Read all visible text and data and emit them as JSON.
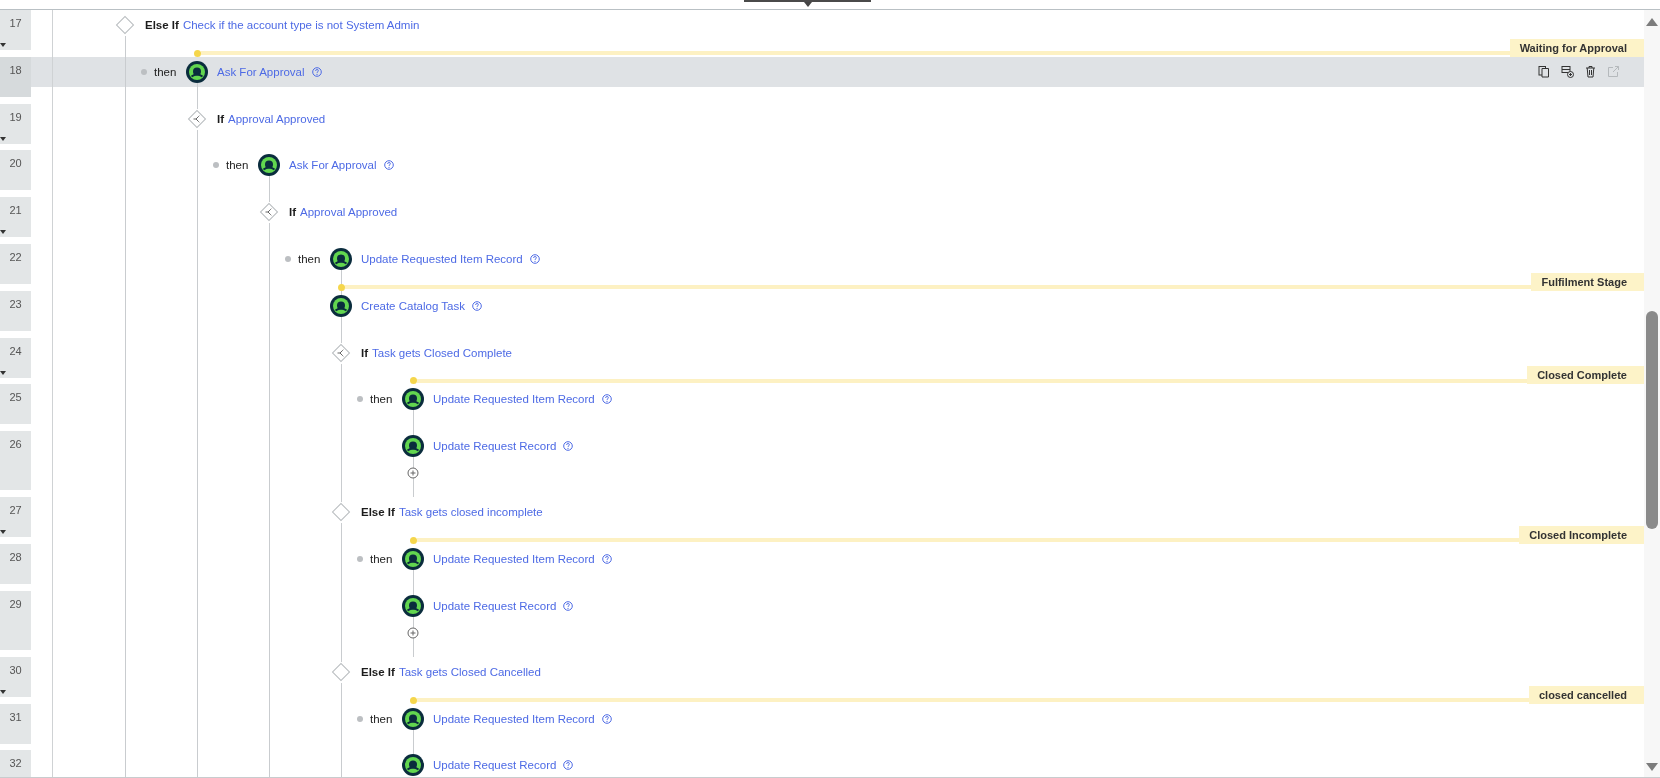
{
  "steps": [
    {
      "number": "17",
      "kind": "else_if",
      "keyword": "Else If",
      "label": "Check if the account type is not System Admin",
      "selected": false,
      "children": [
        {
          "number": "18",
          "kind": "action",
          "prefix": "then",
          "label": "Ask For Approval",
          "stage": "Waiting for Approval",
          "selected": true,
          "row_actions": [
            {
              "kind": "copy",
              "disabled": false
            },
            {
              "kind": "duplicate",
              "disabled": false
            },
            {
              "kind": "delete",
              "disabled": false
            },
            {
              "kind": "open",
              "disabled": true
            }
          ]
        },
        {
          "number": "19",
          "kind": "if",
          "keyword": "If",
          "label": "Approval Approved",
          "selected": false,
          "children": [
            {
              "number": "20",
              "kind": "action",
              "prefix": "then",
              "label": "Ask For Approval",
              "selected": false
            },
            {
              "number": "21",
              "kind": "if",
              "keyword": "If",
              "label": "Approval Approved",
              "selected": false,
              "children": [
                {
                  "number": "22",
                  "kind": "action",
                  "prefix": "then",
                  "label": "Update Requested Item Record",
                  "selected": false
                },
                {
                  "number": "23",
                  "kind": "action",
                  "label": "Create Catalog Task",
                  "stage": "Fulfilment Stage",
                  "selected": false
                },
                {
                  "number": "24",
                  "kind": "if",
                  "keyword": "If",
                  "label": "Task gets Closed Complete",
                  "selected": false,
                  "children": [
                    {
                      "number": "25",
                      "kind": "action",
                      "prefix": "then",
                      "label": "Update Requested Item Record",
                      "stage": "Closed Complete",
                      "selected": false
                    },
                    {
                      "number": "26",
                      "kind": "action",
                      "label": "Update Request Record",
                      "add_button": true,
                      "selected": false
                    }
                  ]
                },
                {
                  "number": "27",
                  "kind": "else_if",
                  "keyword": "Else If",
                  "label": "Task gets closed incomplete",
                  "selected": false,
                  "children": [
                    {
                      "number": "28",
                      "kind": "action",
                      "prefix": "then",
                      "label": "Update Requested Item Record",
                      "stage": "Closed Incomplete",
                      "selected": false
                    },
                    {
                      "number": "29",
                      "kind": "action",
                      "label": "Update Request Record",
                      "add_button": true,
                      "selected": false
                    }
                  ]
                },
                {
                  "number": "30",
                  "kind": "else_if",
                  "keyword": "Else If",
                  "label": "Task gets Closed Cancelled",
                  "selected": false,
                  "children": [
                    {
                      "number": "31",
                      "kind": "action",
                      "prefix": "then",
                      "label": "Update Requested Item Record",
                      "stage": "closed cancelled",
                      "selected": false
                    },
                    {
                      "number": "32",
                      "kind": "action",
                      "label": "Update Request Record",
                      "selected": false
                    }
                  ]
                }
              ]
            }
          ]
        }
      ]
    }
  ]
}
